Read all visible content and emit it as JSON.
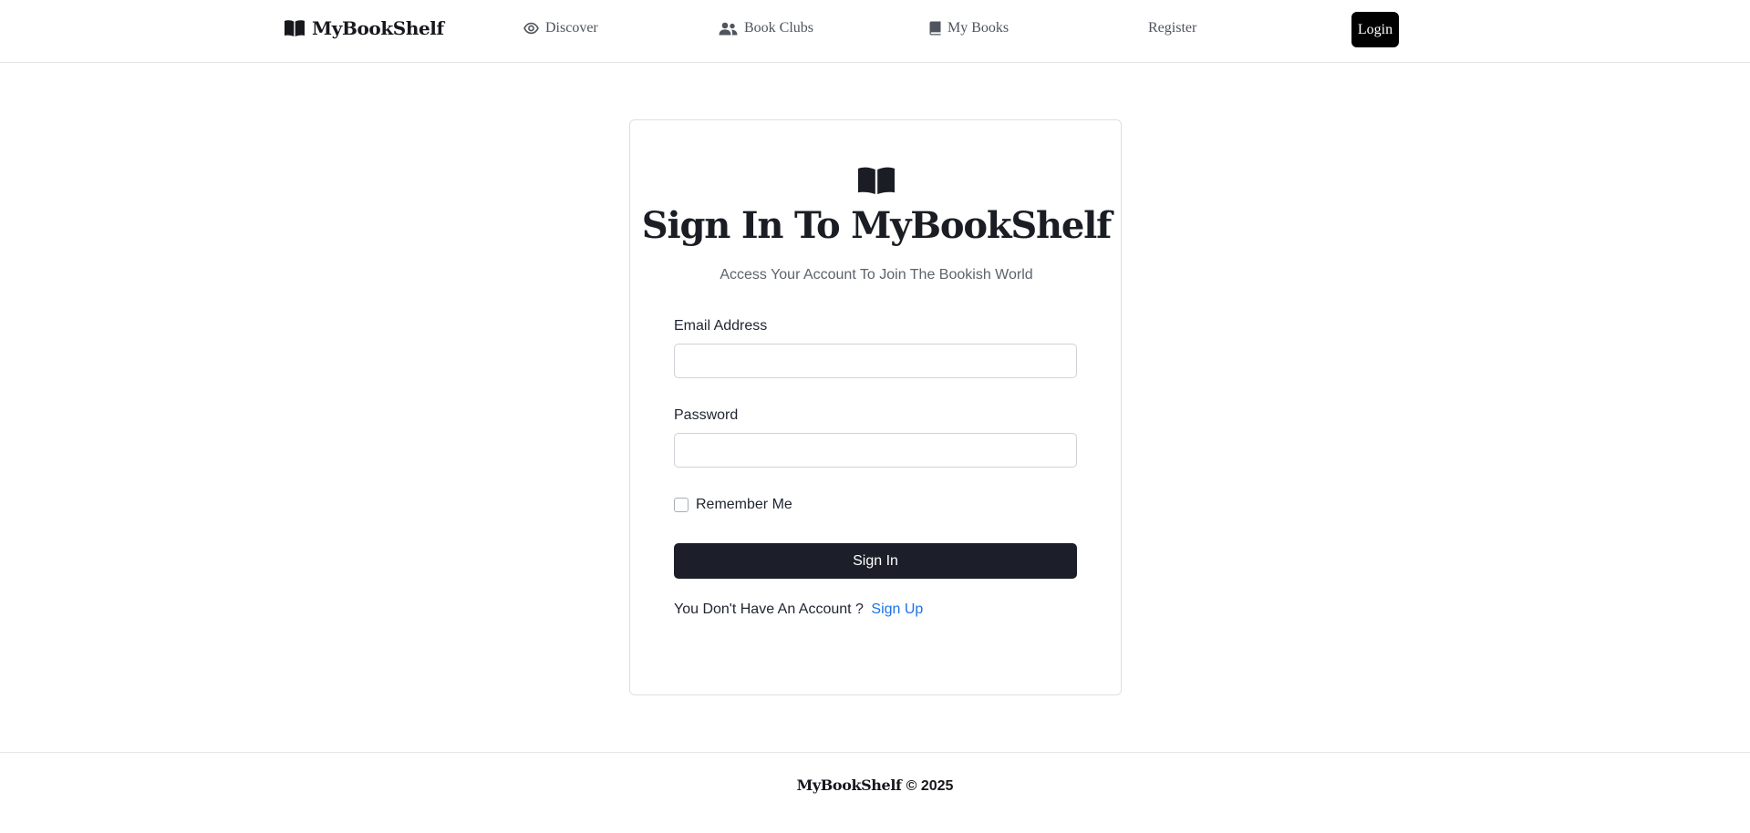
{
  "nav": {
    "brand": "MyBookShelf",
    "brand_icon": "book-open-icon",
    "links": [
      {
        "label": "Discover",
        "icon": "eye-icon"
      },
      {
        "label": "Book Clubs",
        "icon": "users-icon"
      },
      {
        "label": "My Books",
        "icon": "book-icon"
      },
      {
        "label": "Register"
      }
    ],
    "login_label": "Login"
  },
  "card": {
    "icon": "book-open-icon",
    "title": "Sign In To MyBookShelf",
    "subtitle": "Access Your Account To Join The Bookish World",
    "email_label": "Email Address",
    "email_value": "",
    "password_label": "Password",
    "password_value": "",
    "remember_label": "Remember Me",
    "remember_checked": false,
    "signin_label": "Sign In",
    "account_prompt": "You Don't Have An Account ?",
    "signup_label": "Sign Up"
  },
  "footer": {
    "brand": "MyBookShelf",
    "copyright": "© 2025"
  },
  "colors": {
    "primary_button": "#1c1f29",
    "login_button": "#000000",
    "link": "#1a73e8"
  }
}
